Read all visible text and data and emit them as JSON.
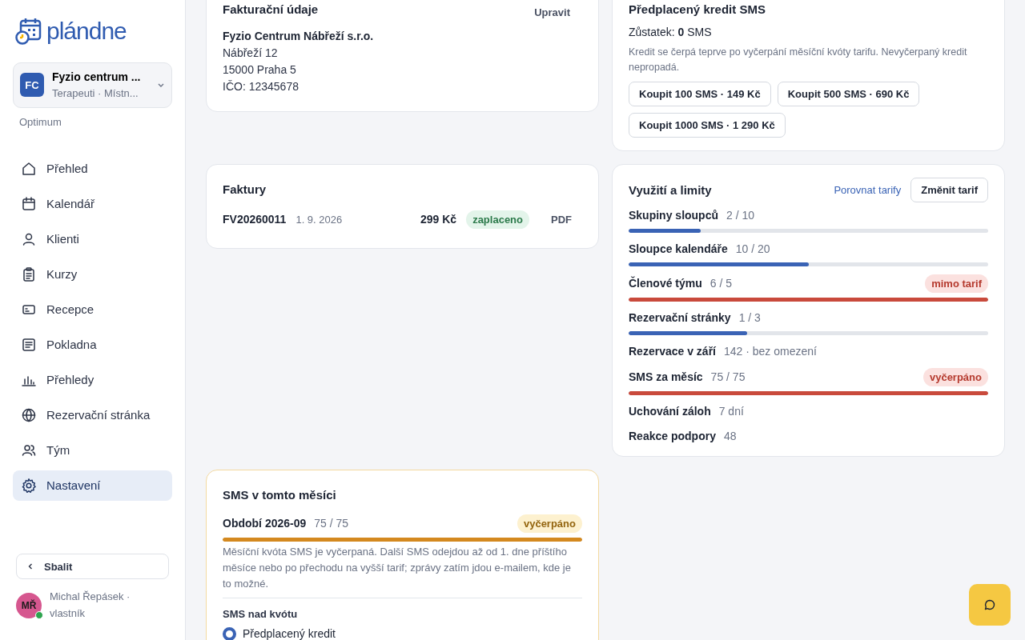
{
  "sidebar": {
    "logo": "**plán**dne",
    "org": {
      "initials": "FC",
      "name": "Fyzio centrum ...",
      "subtitle": "Terapeuti · Místn..."
    },
    "plan": "Optimum",
    "nav": [
      {
        "label": "Přehled",
        "selected": false
      },
      {
        "label": "Kalendář",
        "selected": false
      },
      {
        "label": "Klienti",
        "selected": false
      },
      {
        "label": "Kurzy",
        "selected": false
      },
      {
        "label": "Recepce",
        "selected": false
      },
      {
        "label": "Pokladna",
        "selected": false
      },
      {
        "label": "Přehledy",
        "selected": false
      },
      {
        "label": "Rezervační stránka",
        "selected": false
      },
      {
        "label": "Tým",
        "selected": false
      },
      {
        "label": "Nastavení",
        "selected": true
      }
    ],
    "collapse": "Sbalit",
    "user": {
      "initials": "MŘ",
      "name": "Michal Řepásek · vlastník",
      "online": true
    }
  },
  "billing": {
    "title": "Fakturační údaje",
    "edit": "Upravit",
    "company": "Fyzio Centrum Nábřeží s.r.o.",
    "lines": [
      "Nábřeží 12",
      "15000 Praha 5",
      "IČO: 12345678"
    ]
  },
  "credit": {
    "title": "Předplacený kredit SMS",
    "balance": "Zůstatek: **0** SMS",
    "note": "Kredit se čerpá teprve po vyčerpání měsíční kvóty tarifu. Nevyčerpaný kredit nepropadá.",
    "buttons": [
      "Koupit 100 SMS · 149 Kč",
      "Koupit 500 SMS · 690 Kč",
      "Koupit 1000 SMS · 1 290 Kč"
    ]
  },
  "invoices": {
    "title": "Faktury",
    "rows": [
      {
        "number": "FV20260011",
        "date": "1. 9. 2026",
        "amount": "299 Kč",
        "status": "zaplaceno",
        "download": "PDF"
      }
    ]
  },
  "usage": {
    "title": "Využití a limity",
    "compare": "Porovnat tarify",
    "change": "Změnit tarif",
    "items": [
      {
        "kind": "meter",
        "label": "Skupiny sloupců",
        "value": "2 / 10",
        "level": 0.2,
        "over": false
      },
      {
        "kind": "meter",
        "label": "Sloupce kalendáře",
        "value": "10 / 20",
        "level": 0.5,
        "over": false
      },
      {
        "kind": "meter",
        "label": "Členové týmu",
        "value": "6 / 5",
        "level": 1,
        "over": true,
        "badge": "mimo tarif"
      },
      {
        "kind": "meter",
        "label": "Rezervační stránky",
        "value": "1 / 3",
        "level": 0.33,
        "over": false
      },
      {
        "kind": "plain",
        "label": "Rezervace v září",
        "value": "142 · bez omezení"
      },
      {
        "kind": "meter",
        "label": "SMS za měsíc",
        "value": "75 / 75",
        "level": 1,
        "over": true,
        "badge": "vyčerpáno"
      },
      {
        "kind": "plain",
        "label": "Uchování záloh",
        "value": "7 dní"
      },
      {
        "kind": "plain",
        "label": "Reakce podpory",
        "value": "48"
      }
    ]
  },
  "sms_month": {
    "title": "SMS v tomto měsíci",
    "period": "Období 2026‑09",
    "value": "75 / 75",
    "badge": "vyčerpáno",
    "level": 1,
    "note": "Měsíční kvóta SMS je vyčerpaná. Další SMS odejdou až od 1. dne příštího měsíce nebo po přechodu na vyšší tarif; zprávy zatím jdou e‑mailem, kde je to možné.",
    "section": "SMS nad kvótu",
    "options": [
      {
        "label": "Předplacený kredit",
        "selected": true
      }
    ]
  }
}
